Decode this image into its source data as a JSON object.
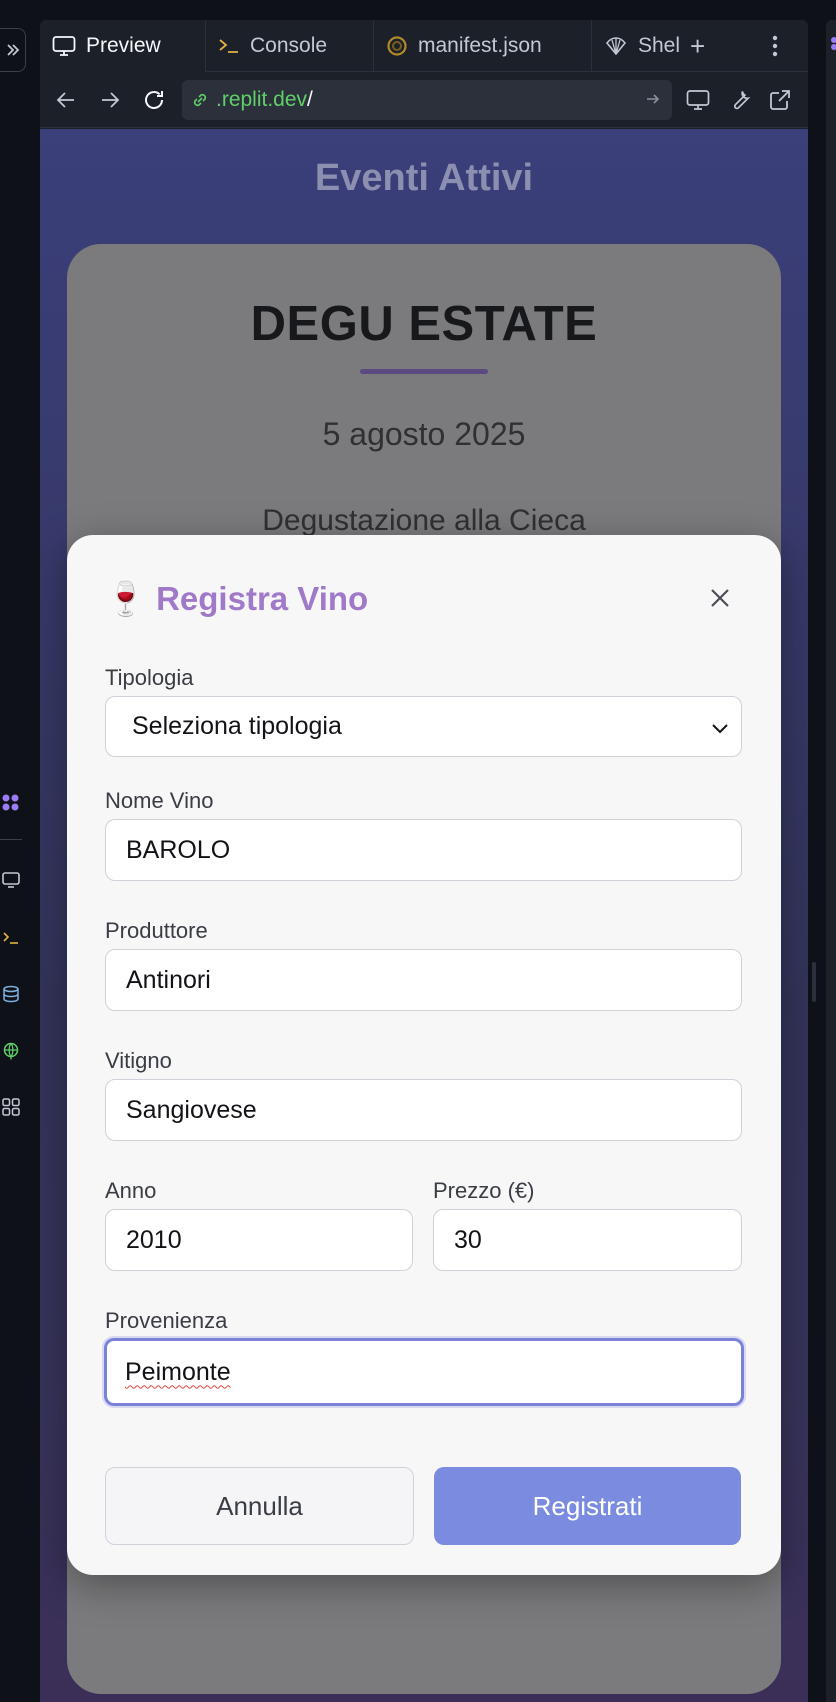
{
  "ide": {
    "tabs": [
      {
        "label": "Preview",
        "icon": "monitor-icon"
      },
      {
        "label": "Console",
        "icon": "terminal-icon"
      },
      {
        "label": "manifest.json",
        "icon": "json-icon"
      },
      {
        "label": "Shel",
        "icon": "shell-icon"
      }
    ],
    "add_tab": "+",
    "url": {
      "host": ".replit.dev",
      "path": "/"
    }
  },
  "page": {
    "title": "Eventi Attivi",
    "event": {
      "name": "DEGU ESTATE",
      "date": "5 agosto 2025",
      "description": "Degustazione alla Cieca"
    }
  },
  "modal": {
    "icon": "🍷",
    "title": "Registra Vino",
    "fields": {
      "tipologia": {
        "label": "Tipologia",
        "value": "Seleziona tipologia"
      },
      "nome": {
        "label": "Nome Vino",
        "value": "BAROLO"
      },
      "produttore": {
        "label": "Produttore",
        "value": "Antinori"
      },
      "vitigno": {
        "label": "Vitigno",
        "value": "Sangiovese"
      },
      "anno": {
        "label": "Anno",
        "value": "2010"
      },
      "prezzo": {
        "label": "Prezzo (€)",
        "value": "30"
      },
      "provenienza": {
        "label": "Provenienza",
        "value": "Peimonte"
      }
    },
    "cancel_label": "Annulla",
    "submit_label": "Registrati"
  },
  "colors": {
    "accent": "#a079c9",
    "submit": "#7b8ce0",
    "focus": "#7a82d9",
    "url_host": "#5fd068"
  }
}
